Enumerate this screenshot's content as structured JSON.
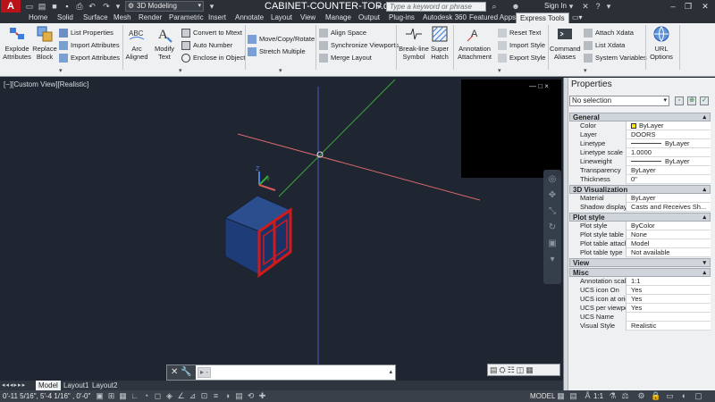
{
  "titlebar": {
    "app_logo": "A",
    "workspace": "3D Modeling",
    "document_title": "CABINET-COUNTER-TOP.dwg",
    "search_placeholder": "Type a keyword or phrase",
    "sign_in": "Sign In"
  },
  "ribbon_tabs": [
    "Home",
    "Solid",
    "Surface",
    "Mesh",
    "Render",
    "Parametric",
    "Insert",
    "Annotate",
    "Layout",
    "View",
    "Manage",
    "Output",
    "Plug-ins",
    "Autodesk 360",
    "Featured Apps",
    "Express Tools"
  ],
  "active_tab": "Express Tools",
  "ribbon": {
    "explode_attributes": [
      "Explode",
      "Attributes"
    ],
    "replace_block": [
      "Replace",
      "Block"
    ],
    "list_properties": "List Properties",
    "import_attributes": "Import Attributes",
    "export_attributes": "Export Attributes",
    "arc_aligned": [
      "Arc",
      "Aligned"
    ],
    "modify_text": [
      "Modify",
      "Text"
    ],
    "convert_to_mtext": "Convert to Mtext",
    "auto_number": "Auto Number",
    "enclose_in_object": "Enclose in Object",
    "move_copy_rotate": "Move/Copy/Rotate",
    "stretch_multiple": "Stretch Multiple",
    "align_space": "Align Space",
    "synchronize_viewports": "Synchronize Viewports",
    "merge_layout": "Merge Layout",
    "break_line_symbol": [
      "Break-line",
      "Symbol"
    ],
    "super_hatch": [
      "Super",
      "Hatch"
    ],
    "annotation_attachment": [
      "Annotation",
      "Attachment"
    ],
    "reset_text": "Reset Text",
    "import_style": "Import Style",
    "export_style": "Export Style",
    "command_aliases": [
      "Command",
      "Aliases"
    ],
    "attach_xdata": "Attach Xdata",
    "list_xdata": "List Xdata",
    "system_variables": "System Variables",
    "url_options": [
      "URL",
      "Options"
    ]
  },
  "viewport": {
    "label": "[−][Custom View][Realistic]",
    "controls": "— □ ×"
  },
  "command_line": {
    "prompt": "▸ -",
    "left_icons": "✕ 🔧"
  },
  "layout_tabs": [
    "Model",
    "Layout1",
    "Layout2"
  ],
  "active_layout": "Model",
  "statusbar": {
    "coords": "0'-11 5/16\", 5'-4 1/16\" , 0'-0\"",
    "model": "MODEL",
    "scale": "1:1"
  },
  "properties": {
    "title": "Properties",
    "selection": "No selection",
    "categories": [
      {
        "name": "General",
        "rows": [
          {
            "name": "Color",
            "value": "ByLayer",
            "kind": "swatch"
          },
          {
            "name": "Layer",
            "value": "DOORS"
          },
          {
            "name": "Linetype",
            "value": "ByLayer",
            "kind": "line"
          },
          {
            "name": "Linetype scale",
            "value": "1.0000"
          },
          {
            "name": "Lineweight",
            "value": "ByLayer",
            "kind": "line"
          },
          {
            "name": "Transparency",
            "value": "ByLayer"
          },
          {
            "name": "Thickness",
            "value": "0\""
          }
        ]
      },
      {
        "name": "3D Visualization",
        "rows": [
          {
            "name": "Material",
            "value": "ByLayer"
          },
          {
            "name": "Shadow display",
            "value": "Casts and Receives Sh..."
          }
        ]
      },
      {
        "name": "Plot style",
        "rows": [
          {
            "name": "Plot style",
            "value": "ByColor"
          },
          {
            "name": "Plot style table",
            "value": "None"
          },
          {
            "name": "Plot table attache...",
            "value": "Model"
          },
          {
            "name": "Plot table type",
            "value": "Not available"
          }
        ]
      },
      {
        "name": "View",
        "rows": []
      },
      {
        "name": "Misc",
        "rows": [
          {
            "name": "Annotation scale",
            "value": "1:1"
          },
          {
            "name": "UCS icon On",
            "value": "Yes"
          },
          {
            "name": "UCS icon at origin",
            "value": "Yes"
          },
          {
            "name": "UCS per viewport",
            "value": "Yes"
          },
          {
            "name": "UCS Name",
            "value": ""
          },
          {
            "name": "Visual Style",
            "value": "Realistic"
          }
        ]
      }
    ]
  },
  "colors": {
    "viewport_bg": "#1f2631",
    "axis_x": "#d66a6a",
    "axis_y": "#39a83a",
    "axis_z": "#4a58c8",
    "cabinet_fill": "#1f3f7a",
    "door_frame": "#d11a1a",
    "active_tab": "#eef0f2"
  }
}
